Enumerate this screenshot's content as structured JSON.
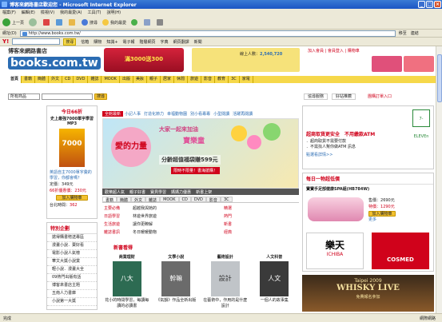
{
  "window": {
    "title": "博客來網路書店歡迎您 - Microsoft Internet Explorer"
  },
  "menu": [
    "檔案(F)",
    "編輯(E)",
    "檢視(V)",
    "我的最愛(A)",
    "工具(T)",
    "說明(H)"
  ],
  "toolbar": {
    "back": "上一頁",
    "search": "搜尋",
    "favorites": "我的最愛"
  },
  "address": {
    "label": "網址(D)",
    "url": "http://www.books.com.tw/",
    "go": "移至",
    "links": "連結"
  },
  "yahoo": {
    "label": "Y!",
    "search": "搜尋",
    "items": [
      "信箱",
      "購物",
      "知識+",
      "電子報",
      "階層網頁",
      "字典",
      "網頁翻譯",
      "新聞"
    ]
  },
  "site": {
    "logo_cn": "博客來網路書店",
    "logo_en": "books.com.tw",
    "promo": "滿3000送300",
    "member_links": "加入會員 | 會員登入 | 購物車",
    "visitors_label": "線上人數：",
    "visitors": "2,540,720",
    "nav": [
      "首頁",
      "書籍",
      "簡體",
      "外文",
      "CD",
      "DVD",
      "雜誌",
      "MOOK",
      "出版",
      "美妝",
      "親子",
      "居家",
      "休閒",
      "旅遊",
      "影音",
      "教育",
      "3C",
      "家電"
    ],
    "search": {
      "select": "所有商品",
      "button": "搜尋"
    },
    "util_links": [
      "協尋服務",
      "好站推薦",
      "團購訂單入口"
    ],
    "left": {
      "deal_title": "今日66折",
      "deal_heading": "史上最強7000單字學習MP3",
      "deal_book": "7000",
      "deal_desc": "英語自主7000單字彙的學習，你都會嗎？",
      "deal_price_label": "定價：",
      "deal_price": "349元",
      "deal_sale": "66折優惠價：230元",
      "cart_btn": "加入購物車",
      "countdown": "台北時間：",
      "countdown_val": "362",
      "special_title": "特別企劃",
      "special": [
        "搶得購書贈送專區",
        "漫畫小說．賣好看",
        "電影小說人氣榜",
        "華文大獎小說賞",
        "輕小說．漫畫大全",
        "09熱門出版有話",
        "博客來書店主題",
        "五南人力書庫",
        "小說第一大獎"
      ]
    },
    "center": {
      "tabs": [
        "全館最新",
        "小記人事",
        "打造化節力",
        "幸福動物園",
        "別小看專專",
        "小型閱讀",
        "活躍再閱讀"
      ],
      "banner_title": "愛的力量",
      "banner_sub": "大家一起來加油",
      "banner_brand": "寶樂童",
      "banner_price": "分齡超值福袋賺599元",
      "banner_btn": "限時不限量！書海搶購！",
      "banner_links": [
        "歡樂超人氣",
        "親子好書",
        "寶貝學習",
        "媽媽力優惠",
        "新書上架"
      ],
      "cat_tabs": [
        "書籍",
        "簡體",
        "外文",
        "雜誌",
        "MOOK",
        "CD",
        "DVD",
        "影音",
        "3C"
      ],
      "news_left": [
        "主要必備",
        "日語學習",
        "生活旅遊",
        "雜誌書訊"
      ],
      "news_mid": [
        "超越我與她的",
        "林遊世界旅遊",
        "讓你更瞭解",
        "冬日暖暖動物"
      ],
      "news_right": [
        "精選",
        "熱門",
        "新書",
        "經典"
      ],
      "new_title": "新書看得",
      "new_cats": [
        "商業理財",
        "文學小說",
        "藝術設計",
        "人文科普"
      ],
      "new_books": [
        {
          "title": "八大",
          "desc": "花小的時間學習，每讀每讀的必讀書"
        },
        {
          "title": "幹嘛",
          "desc": "《氣韻》作品全新出版"
        },
        {
          "title": "設計",
          "desc": "在藝術中，作用的是什麼設計"
        },
        {
          "title": "人文",
          "desc": "一個人的故事集"
        }
      ]
    },
    "right": {
      "ad_title": "超商取貨更安全　不用繳款ATM",
      "ad_lines": [
        "．超商取貨不需要付款",
        "．不需找人幫你做ATM 訊息"
      ],
      "ad_link": "點選看詳情>>",
      "seven": "7-ELEVEn",
      "flash_title": "每日一物超低價",
      "flash_heading": "寶寶手足部健康SPA組(HB784W)",
      "flash_price": "售價：",
      "flash_price_val": "2690元",
      "flash_sale_label": "特價：",
      "flash_sale": "1290元",
      "flash_cart": "加入購物車",
      "flash_more": "更多",
      "rakuten": "樂天",
      "rakuten_sub": "ICHIBA",
      "cosmed": "COSMED",
      "whisky_city": "Taipei 2009",
      "whisky_text": "WHISKY LIVE",
      "whisky_sub": "免費報名參加"
    }
  },
  "status": {
    "text": "完成",
    "zone": "網際網路"
  }
}
